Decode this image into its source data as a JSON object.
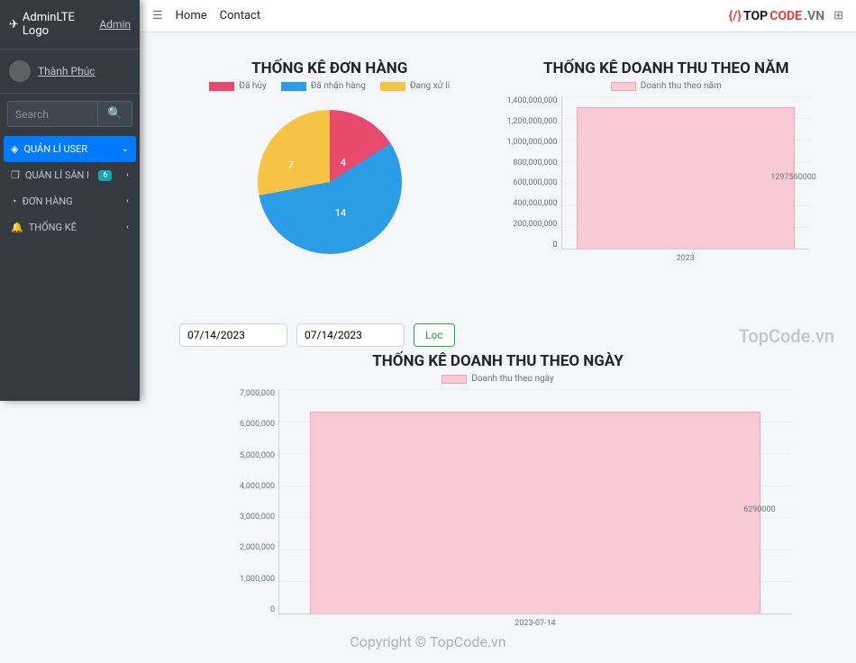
{
  "sidebar": {
    "brand": "AdminLTE Logo",
    "admin_link": "Admin",
    "user_name": "Thành Phúc",
    "search_placeholder": "Search",
    "menu": [
      {
        "label": "QUẢN LÍ USER",
        "active": true,
        "caret": "down"
      },
      {
        "label": "QUẢN LÍ SẢN PHẨM",
        "badge": "6",
        "caret": "left"
      },
      {
        "label": "ĐƠN HÀNG",
        "caret": "left"
      },
      {
        "label": "THỐNG KÊ",
        "caret": "left"
      }
    ]
  },
  "topbar": {
    "links": [
      "Home",
      "Contact"
    ],
    "watermark": {
      "prefix": "{/}",
      "top": "TOP",
      "code": "CODE",
      "suffix": ".VN"
    }
  },
  "filters": {
    "date_from": "07/14/2023",
    "date_to": "07/14/2023",
    "button": "Lọc"
  },
  "watermark_text": "TopCode.vn",
  "copyright": "Copyright © TopCode.vn",
  "chart_data": [
    {
      "type": "pie",
      "title": "THỐNG KÊ ĐƠN HÀNG",
      "series": [
        {
          "name": "Đã hủy",
          "value": 4,
          "color": "#e74a6d"
        },
        {
          "name": "Đã nhận hàng",
          "value": 14,
          "color": "#2b9ce6"
        },
        {
          "name": "Đang xử lí",
          "value": 7,
          "color": "#f6c344"
        }
      ]
    },
    {
      "type": "bar",
      "title": "THỐNG KÊ DOANH THU THEO NĂM",
      "legend": "Doanh thu theo năm",
      "categories": [
        "2023"
      ],
      "values": [
        1297560000
      ],
      "ylim": [
        0,
        1400000000
      ],
      "yticks": [
        0,
        200000000,
        400000000,
        600000000,
        800000000,
        1000000000,
        1200000000,
        1400000000
      ]
    },
    {
      "type": "bar",
      "title": "THỐNG KÊ DOANH THU THEO NGÀY",
      "legend": "Doanh thu theo ngày",
      "categories": [
        "2023-07-14"
      ],
      "values": [
        6290000
      ],
      "ylim": [
        0,
        7000000
      ],
      "yticks": [
        0,
        1000000,
        2000000,
        3000000,
        4000000,
        5000000,
        6000000,
        7000000
      ]
    }
  ]
}
